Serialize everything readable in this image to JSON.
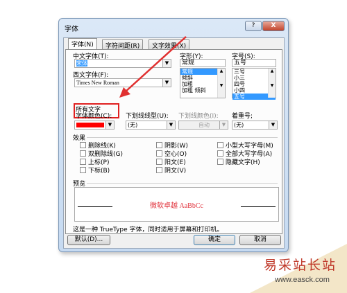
{
  "window": {
    "title": "字体",
    "help": "?",
    "close": "X"
  },
  "tabs": [
    {
      "label": "字体(N)"
    },
    {
      "label": "字符间距(R)"
    },
    {
      "label": "文字效果(X)"
    }
  ],
  "font": {
    "chinese_label": "中文字体(T):",
    "chinese_value": "宋体",
    "western_label": "西文字体(F):",
    "western_value": "Times New Roman",
    "style_label": "字形(Y):",
    "style_value": "常规",
    "style_options": [
      "常规",
      "倾斜",
      "加粗",
      "加粗 倾斜"
    ],
    "size_label": "字号(S):",
    "size_value": "五号",
    "size_options": [
      "三号",
      "小三",
      "四号",
      "小四",
      "五号"
    ]
  },
  "all_text": {
    "heading": "所有文字",
    "color_label": "字体颜色(C):",
    "color_value": "#ff0000",
    "underline_label": "下划线线型(U):",
    "underline_value": "(无)",
    "underline_color_label": "下划线颜色(I):",
    "underline_color_value": "自动",
    "emphasis_label": "着重号;",
    "emphasis_value": "(无)"
  },
  "effects": {
    "heading": "效果",
    "col1": [
      "删除线(K)",
      "双删除线(G)",
      "上标(P)",
      "下标(B)"
    ],
    "col2": [
      "阴影(W)",
      "空心(O)",
      "阳文(E)",
      "阴文(V)"
    ],
    "col3": [
      "小型大写字母(M)",
      "全部大写字母(A)",
      "隐藏文字(H)"
    ]
  },
  "preview": {
    "heading": "预览",
    "sample": "微软卓越 AaBbCc",
    "sample_color": "#e0303a"
  },
  "note": "这是一种 TrueType 字体，同时适用于屏幕和打印机。",
  "buttons": {
    "default": "默认(D)...",
    "ok": "确定",
    "cancel": "取消"
  },
  "watermark": {
    "name": "易采站长站",
    "url": "www.easck.com"
  },
  "colors": {
    "highlight_box": "#e02020",
    "arrow": "#e03030",
    "selection": "#3399ff"
  }
}
